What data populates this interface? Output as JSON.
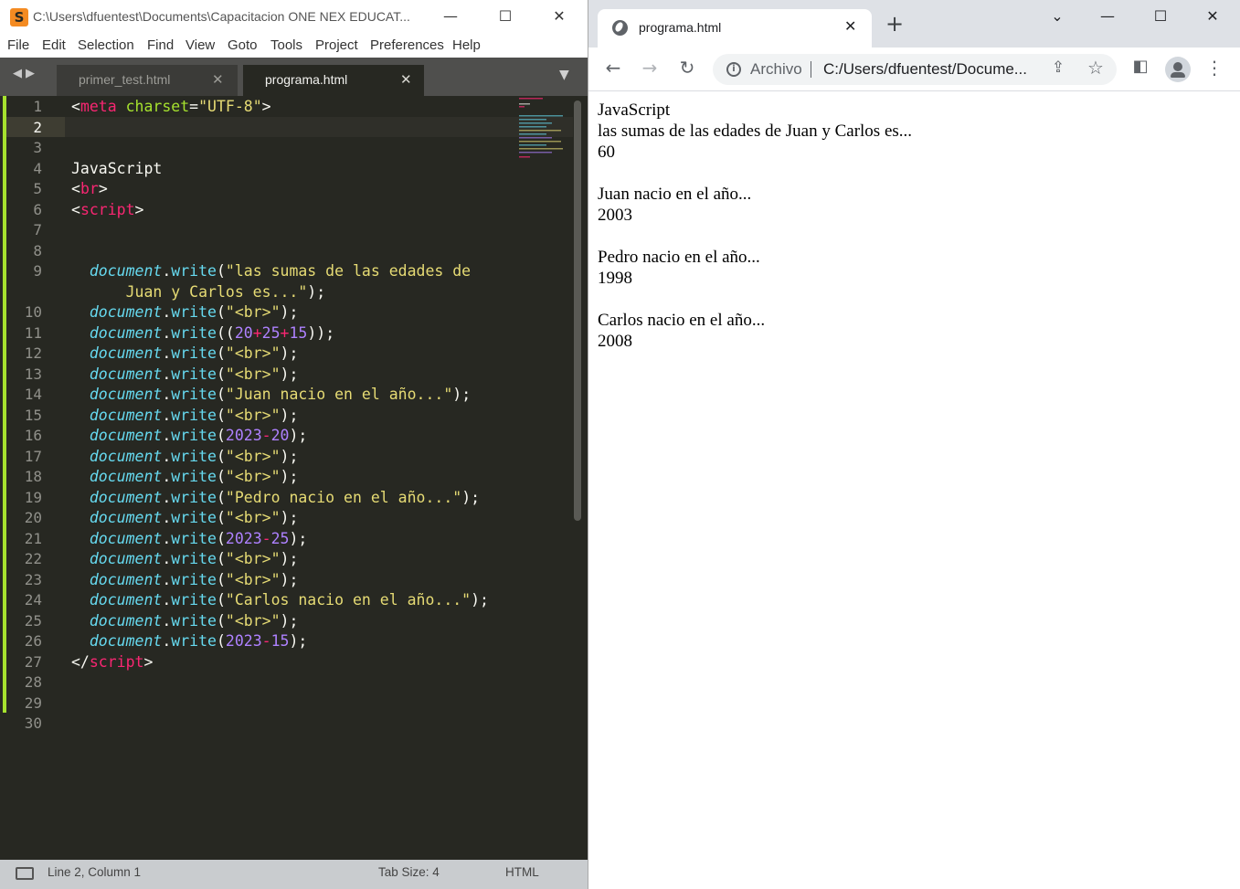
{
  "sublime": {
    "title": "C:\\Users\\dfuentest\\Documents\\Capacitacion ONE NEX EDUCAT...",
    "menu": [
      "File",
      "Edit",
      "Selection",
      "Find",
      "View",
      "Goto",
      "Tools",
      "Project",
      "Preferences",
      "Help"
    ],
    "tabs": [
      {
        "label": "primer_test.html",
        "active": false
      },
      {
        "label": "programa.html",
        "active": true
      }
    ],
    "line_numbers": [
      "1",
      "2",
      "3",
      "4",
      "5",
      "6",
      "7",
      "8",
      "9",
      "10",
      "11",
      "12",
      "13",
      "14",
      "15",
      "16",
      "17",
      "18",
      "19",
      "20",
      "21",
      "22",
      "23",
      "24",
      "25",
      "26",
      "27",
      "28",
      "29",
      "30"
    ],
    "code": {
      "l1_tag": "meta",
      "l1_attr": "charset",
      "l1_val": "\"UTF-8\"",
      "l4_text": "JavaScript",
      "l5_tag": "br",
      "l6_tag": "script",
      "doc": "document",
      "write": "write",
      "l9_str_a": "\"las sumas de las edades de",
      "l9_str_b": "Juan y Carlos es...\"",
      "br_str": "\"<br>\"",
      "l11_a": "20",
      "l11_b": "25",
      "l11_c": "15",
      "l14_str": "\"Juan nacio en el año...\"",
      "year": "2023",
      "l16_sub": "20",
      "l19_str": "\"Pedro nacio en el año...\"",
      "l21_sub": "25",
      "l24_str": "\"Carlos nacio en el año...\"",
      "l26_sub": "15",
      "l27_tag": "script"
    },
    "status": {
      "position": "Line 2, Column 1",
      "tab_size": "Tab Size: 4",
      "syntax": "HTML"
    },
    "colors": {
      "background": "#272822",
      "tag": "#f92672",
      "attr": "#a6e22e",
      "string": "#e6db74",
      "object": "#66d9ef",
      "number": "#ae81ff"
    }
  },
  "chrome": {
    "tab_title": "programa.html",
    "tab_close": "✕",
    "new_tab": "+",
    "omnibox_label": "Archivo",
    "url": "C:/Users/dfuentest/Docume...",
    "window_controls": {
      "dropdown": "⌄",
      "minimize": "—",
      "maximize": "☐",
      "close": "✕"
    },
    "toolbar_icons": [
      "back-icon",
      "forward-icon",
      "reload-icon",
      "share-icon",
      "star-icon",
      "side-panel-icon",
      "profile-icon",
      "menu-icon"
    ],
    "page_lines": [
      "JavaScript",
      "las sumas de las edades de Juan y Carlos es...",
      "60",
      "",
      "Juan nacio en el año...",
      "2003",
      "",
      "Pedro nacio en el año...",
      "1998",
      "",
      "Carlos nacio en el año...",
      "2008"
    ]
  }
}
